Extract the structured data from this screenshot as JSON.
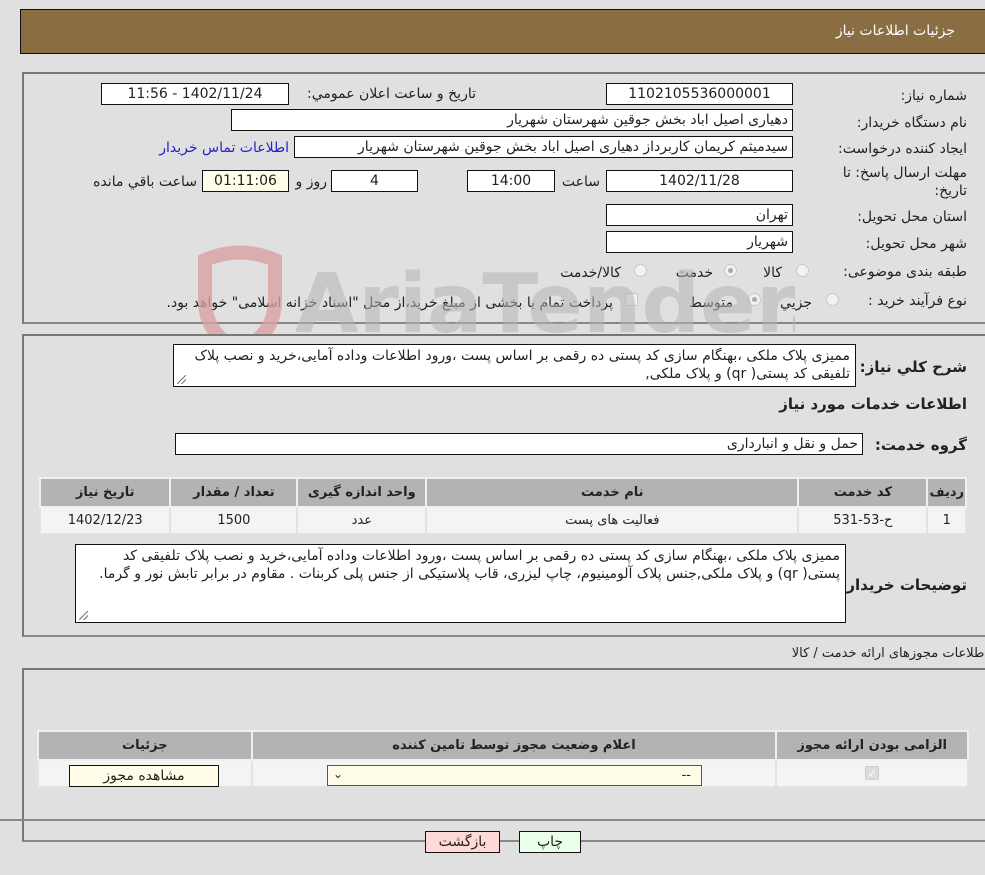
{
  "header": {
    "title": "جزئیات اطلاعات نیاز"
  },
  "details": {
    "need_number_label": "شماره نیاز:",
    "need_number": "1102105536000001",
    "announce_label": "تاریخ و ساعت اعلان عمومي:",
    "announce_value": "1402/11/24 - 11:56",
    "buyer_org_label": "نام دستگاه خریدار:",
    "buyer_org": "دهیاری اصیل اباد بخش جوقین شهرستان شهریار",
    "requester_label": "ایجاد کننده درخواست:",
    "requester": "سیدمیثم کریمان کاربرداز دهیاری اصیل اباد بخش جوقین شهرستان شهریار",
    "contact_link": "اطلاعات تماس خریدار",
    "deadline_label_line1": "مهلت ارسال پاسخ: تا",
    "deadline_label_line2": "تاریخ:",
    "deadline_date": "1402/11/28",
    "time_label": "ساعت",
    "deadline_time": "14:00",
    "days": "4",
    "days_label": "روز و",
    "remaining": "01:11:06",
    "remaining_label": "ساعت باقي مانده",
    "province_label": "استان محل تحویل:",
    "province": "تهران",
    "city_label": "شهر محل تحویل:",
    "city": "شهریار",
    "category_label": "طبقه بندی موضوعی:",
    "category_options": [
      {
        "label": "کالا",
        "checked": false
      },
      {
        "label": "خدمت",
        "checked": true
      },
      {
        "label": "کالا/خدمت",
        "checked": false
      }
    ],
    "process_label": "نوع فرآیند خرید :",
    "process_options": [
      {
        "label": "جزیي",
        "checked": false
      },
      {
        "label": "متوسط",
        "checked": true
      }
    ],
    "treasury_note": "پرداخت تمام یا بخشی از مبلغ خرید،از محل \"اسناد خزانه اسلامی\" خواهد بود.",
    "treasury_checked": false
  },
  "description": {
    "label": "شرح کلي نياز:",
    "text": "ممیزی پلاک ملکی ،بهنگام سازی کد پستی ده رقمی بر اساس پست ،ورود اطلاعات وداده آمایی،خرید و نصب پلاک تلفیقی کد پستی( qr) و پلاک ملکی,"
  },
  "services": {
    "section_title": "اطلاعات خدمات مورد نیاز",
    "group_label": "گروه خدمت:",
    "group_value": "حمل و نقل و انبارداری",
    "columns": [
      "ردیف",
      "کد خدمت",
      "نام خدمت",
      "واحد اندازه گیری",
      "تعداد / مقدار",
      "تاریخ نیاز"
    ],
    "rows": [
      [
        "1",
        "ح-53-531",
        "فعالیت های پست",
        "عدد",
        "1500",
        "1402/12/23"
      ]
    ]
  },
  "buyer_notes": {
    "label": "توضیحات خریدار:",
    "text": "ممیزی پلاک ملکی ،بهنگام سازی کد پستی ده رقمی بر اساس پست ،ورود اطلاعات وداده آمایی،خرید و نصب پلاک تلفیقی کد پستی( qr) و پلاک ملکی,جنس پلاک آلومینیوم، چاپ لیزری، قاب پلاستیکی از جنس پلی کربنات . مقاوم در برابر تابش نور و گرما."
  },
  "permits": {
    "section_title": "اطلاعات مجوزهای ارائه خدمت / کالا",
    "columns": [
      "الزامی بودن ارائه مجوز",
      "اعلام وضعیت مجوز توسط تامین کننده",
      "جزئیات"
    ],
    "row": {
      "required_checked": true,
      "status_value": "--",
      "view_button": "مشاهده مجوز"
    }
  },
  "footer": {
    "print_button": "چاپ",
    "back_button": "بازگشت"
  },
  "watermark": {
    "text": "AriaTender.neT"
  }
}
